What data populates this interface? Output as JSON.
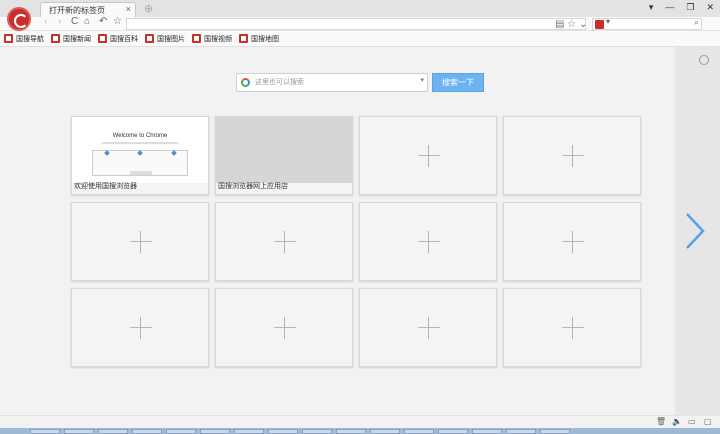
{
  "tab": {
    "title": "打开新的标签页",
    "close": "×"
  },
  "window": {
    "new_tab": "⊕",
    "controls": [
      "▾",
      "—",
      "❐",
      "✕"
    ]
  },
  "nav": {
    "back": "‹",
    "forward": "›",
    "reload": "C",
    "home": "⌂",
    "undo": "↶",
    "star": "☆"
  },
  "address": {
    "value": "",
    "reader": "▤",
    "favorite": "☆",
    "dropdown": "⌄"
  },
  "search_engine": {
    "caret": "▾",
    "search_icon": "⌕"
  },
  "bookmarks": [
    {
      "label": "国搜导航"
    },
    {
      "label": "国搜新闻"
    },
    {
      "label": "国搜百科"
    },
    {
      "label": "国搜图片"
    },
    {
      "label": "国搜视频"
    },
    {
      "label": "国搜地图"
    }
  ],
  "search": {
    "placeholder": "这里也可以搜索",
    "dropdown": "▾",
    "button": "搜索一下"
  },
  "tiles": [
    {
      "label": "欢迎使用国搜浏览器",
      "type": "chrome"
    },
    {
      "label": "国搜浏览器网上应用店",
      "type": "grey"
    },
    {
      "label": "",
      "type": "empty"
    },
    {
      "label": "",
      "type": "empty"
    },
    {
      "label": "",
      "type": "empty"
    },
    {
      "label": "",
      "type": "empty"
    },
    {
      "label": "",
      "type": "empty"
    },
    {
      "label": "",
      "type": "empty"
    },
    {
      "label": "",
      "type": "empty"
    },
    {
      "label": "",
      "type": "empty"
    },
    {
      "label": "",
      "type": "empty"
    },
    {
      "label": "",
      "type": "empty"
    }
  ],
  "thumb": {
    "welcome_title": "Welcome to Chrome"
  },
  "status": {
    "trash": "🗑",
    "volume": "🔈",
    "window": "▭",
    "page": "▢"
  },
  "colors": {
    "accent": "#6db3f2",
    "brand": "#c9302c",
    "arrow": "#5b9ee6"
  }
}
